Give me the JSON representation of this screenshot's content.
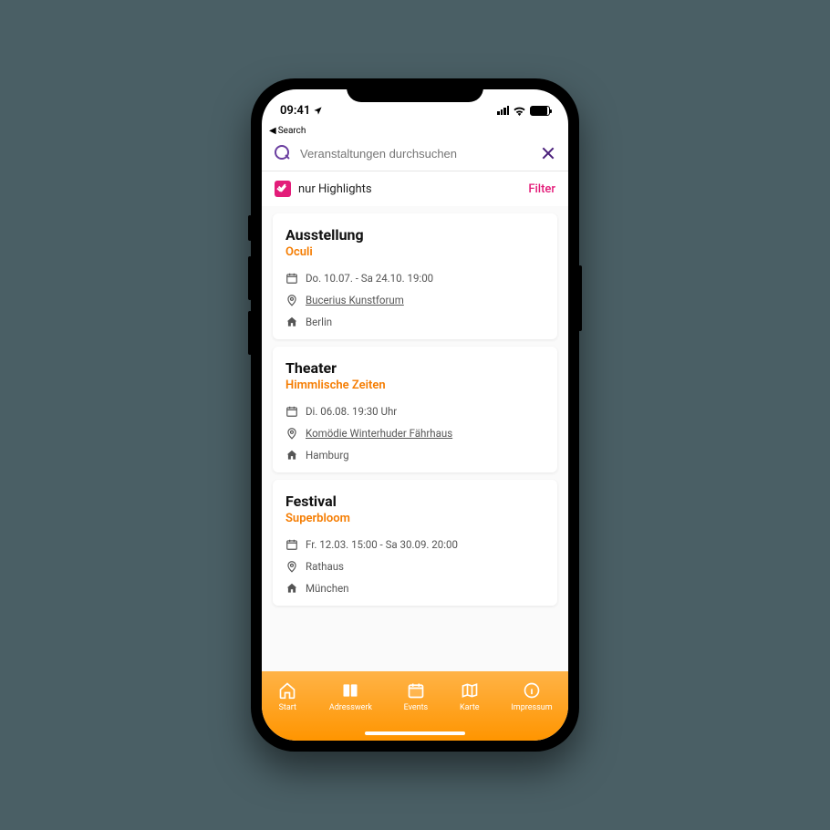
{
  "status": {
    "time": "09:41",
    "back_label": "Search"
  },
  "search": {
    "placeholder": "Veranstaltungen durchsuchen"
  },
  "filter": {
    "checkbox_label": "nur Highlights",
    "filter_label": "Filter"
  },
  "events": [
    {
      "category": "Ausstellung",
      "title": "Oculi",
      "date": "Do. 10.07. - Sa 24.10. 19:00",
      "venue": "Bucerius Kunstforum",
      "venue_link": true,
      "city": "Berlin"
    },
    {
      "category": "Theater",
      "title": "Himmlische Zeiten",
      "date": "Di. 06.08. 19:30 Uhr",
      "venue": "Komödie Winterhuder Fährhaus",
      "venue_link": true,
      "city": "Hamburg"
    },
    {
      "category": "Festival",
      "title": "Superbloom",
      "date": "Fr. 12.03. 15:00 - Sa 30.09. 20:00",
      "venue": "Rathaus",
      "venue_link": false,
      "city": "München"
    }
  ],
  "nav": [
    {
      "label": "Start"
    },
    {
      "label": "Adresswerk"
    },
    {
      "label": "Events"
    },
    {
      "label": "Karte"
    },
    {
      "label": "Impressum"
    }
  ]
}
